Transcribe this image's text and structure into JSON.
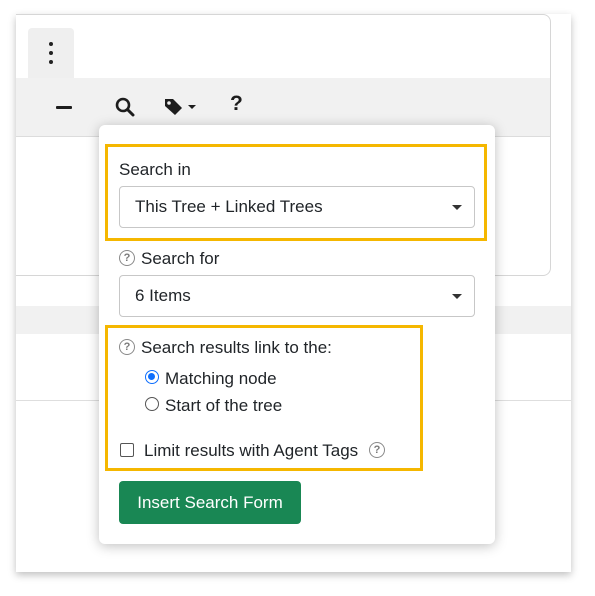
{
  "toolbar": {
    "collapse_icon": "minus-icon",
    "search_icon": "search-icon",
    "tag_icon": "tag-dropdown-icon",
    "help_label": "?"
  },
  "search_panel": {
    "search_in_label": "Search in",
    "search_in_value": "This Tree + Linked Trees",
    "search_for_label": "Search for",
    "search_for_value": "6 Items",
    "results_link_label": "Search results link to the:",
    "radio_matching": "Matching node",
    "radio_start": "Start of the tree",
    "limit_label": "Limit results with Agent Tags",
    "insert_button": "Insert Search Form",
    "help_glyph": "?"
  },
  "colors": {
    "highlight": "#f5b700",
    "button_green": "#198754",
    "radio_blue": "#0d6efd"
  }
}
